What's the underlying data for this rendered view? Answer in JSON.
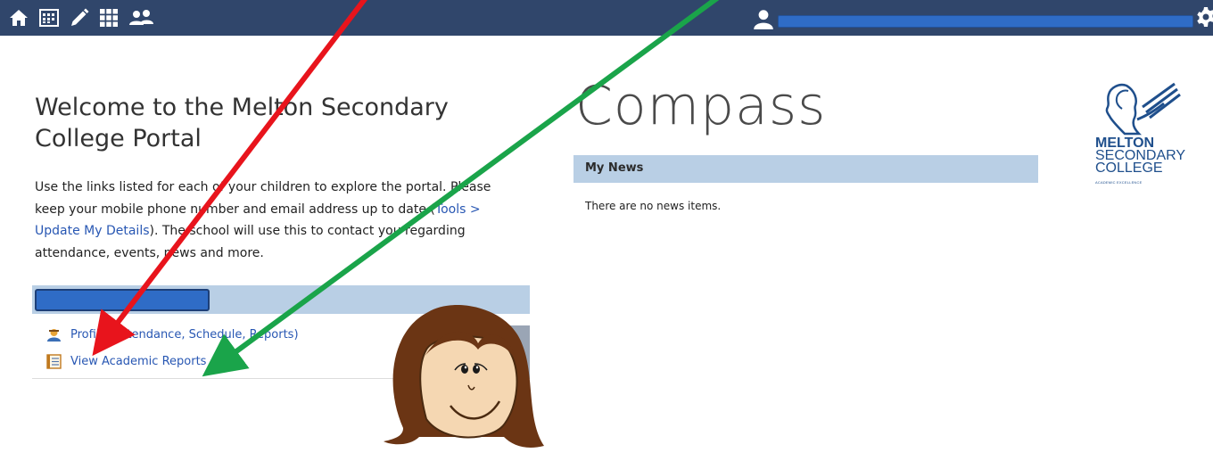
{
  "nav": {
    "icons": [
      "home-icon",
      "calendar-icon",
      "pencil-icon",
      "grid-icon",
      "people-icon"
    ],
    "right_icons": [
      "user-icon",
      "gear-icon"
    ]
  },
  "welcome": {
    "title": "Welcome to the Melton Secondary College Portal",
    "intro_prefix": "Use the links listed for each of your children to explore the portal. Please keep your mobile phone number and email address up to date (",
    "intro_link": "Tools > Update My Details",
    "intro_suffix": "). The school will use this to contact you regarding attendance, events, news and more."
  },
  "child": {
    "links": [
      {
        "label": "Profile (Attendance, Schedule, Reports)",
        "icon": "profile-icon"
      },
      {
        "label": "View Academic Reports",
        "icon": "report-icon"
      }
    ]
  },
  "compass": {
    "logo_text": "Compass",
    "news_title": "My News",
    "news_empty": "There are no news items."
  },
  "school": {
    "name_line1": "MELTON",
    "name_line2": "SECONDARY",
    "name_line3": "COLLEGE",
    "tagline": "ACADEMIC EXCELLENCE"
  },
  "colors": {
    "topbar": "#30466b",
    "header_band": "#b9cfe5",
    "link": "#2857b3",
    "red_arrow": "#e8141c",
    "green_arrow": "#1aa44a"
  }
}
